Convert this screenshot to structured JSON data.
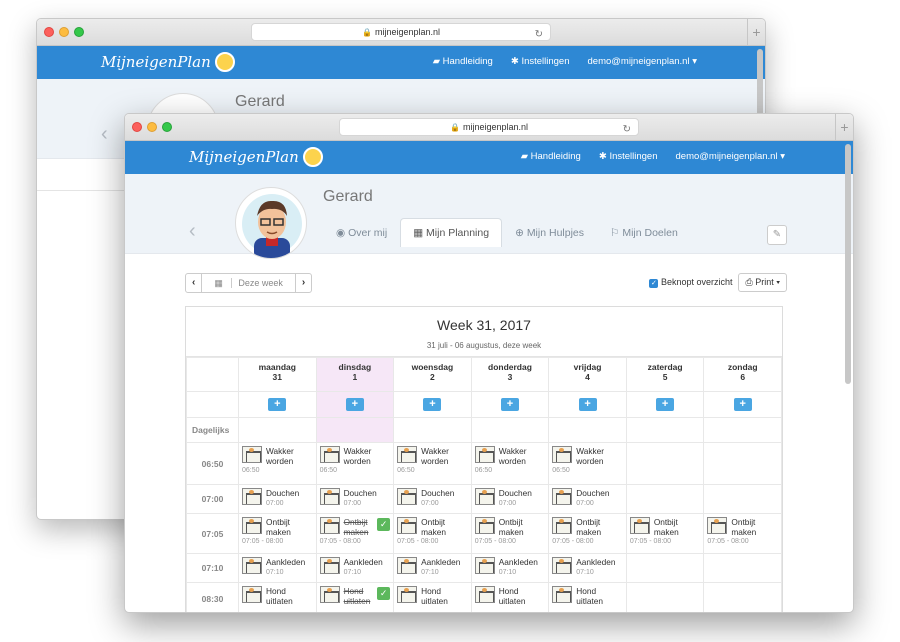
{
  "browser": {
    "url": "mijneigenplan.nl"
  },
  "app": {
    "logo": "MijneigenPlan",
    "nav": {
      "manual": "Handleiding",
      "settings": "Instellingen",
      "account": "demo@mijneigenplan.nl"
    }
  },
  "profile": {
    "name": "Gerard"
  },
  "tabs": [
    {
      "label": "Over mij",
      "icon": "user-circle-icon"
    },
    {
      "label": "Mijn Planning",
      "icon": "calendar-icon"
    },
    {
      "label": "Mijn Hulpjes",
      "icon": "lifebuoy-icon"
    },
    {
      "label": "Mijn Doelen",
      "icon": "flag-icon"
    }
  ],
  "toolbar": {
    "this_week": "Deze week",
    "compact": "Beknopt overzicht",
    "print": "Print"
  },
  "week": {
    "title": "Week 31, 2017",
    "range": "31 juli - 06 augustus",
    "range_suffix": ", deze week"
  },
  "days": [
    {
      "name": "maandag",
      "num": "31"
    },
    {
      "name": "dinsdag",
      "num": "1"
    },
    {
      "name": "woensdag",
      "num": "2"
    },
    {
      "name": "donderdag",
      "num": "3"
    },
    {
      "name": "vrijdag",
      "num": "4"
    },
    {
      "name": "zaterdag",
      "num": "5"
    },
    {
      "name": "zondag",
      "num": "6"
    }
  ],
  "daily_label": "Dagelijks",
  "rows": [
    {
      "time": "06:50",
      "label": "Wakker worden",
      "slot": "06:50"
    },
    {
      "time": "07:00",
      "label": "Douchen",
      "slot": "07:00"
    },
    {
      "time": "07:05",
      "label": "Ontbijt maken",
      "slot": "07:05 - 08:00"
    },
    {
      "time": "07:10",
      "label": "Aankleden",
      "slot": "07:10"
    },
    {
      "time": "08:30",
      "label": "Hond uitlaten",
      "slot": ""
    }
  ],
  "colors": {
    "primary": "#2e88d4",
    "today": "#f6e7f7",
    "done": "#5cb85c"
  }
}
